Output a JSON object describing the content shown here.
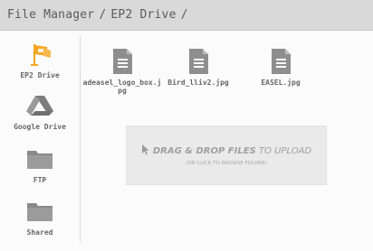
{
  "breadcrumb": {
    "root": "File Manager",
    "current": "EP2 Drive",
    "separator": "/"
  },
  "sidebar": {
    "items": [
      {
        "label": "EP2 Drive",
        "icon": "ep2-flag-icon",
        "color": "#f5a623"
      },
      {
        "label": "Google Drive",
        "icon": "google-drive-icon",
        "color": "#8a8a8a"
      },
      {
        "label": "FTP",
        "icon": "folder-icon",
        "color": "#8a8a8a"
      },
      {
        "label": "Shared",
        "icon": "folder-icon",
        "color": "#8a8a8a"
      }
    ]
  },
  "files": [
    {
      "name": "adeasel_logo_box.jpg",
      "icon": "document-icon"
    },
    {
      "name": "Bird_lliv2.jpg",
      "icon": "document-icon"
    },
    {
      "name": "EASEL.jpg",
      "icon": "document-icon"
    }
  ],
  "dropzone": {
    "strong": "DRAG & DROP FILES",
    "rest": " TO UPLOAD",
    "sub": "(OR CLICK TO BROWSE FOLDER)"
  },
  "colors": {
    "header_bg": "#d9d9d9",
    "accent": "#f5a623",
    "icon_gray": "#8a8a8a"
  }
}
